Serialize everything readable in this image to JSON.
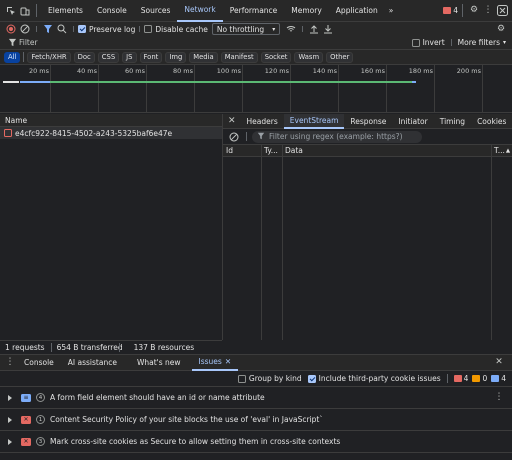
{
  "topbar": {
    "tabs": [
      "Elements",
      "Console",
      "Sources",
      "Network",
      "Performance",
      "Memory",
      "Application"
    ],
    "active_tab": "Network",
    "more": "»",
    "error_count": "4"
  },
  "toolbar": {
    "preserve_log": "Preserve log",
    "disable_cache": "Disable cache",
    "throttling": "No throttling"
  },
  "filter": {
    "placeholder": "Filter",
    "invert": "Invert",
    "more_filters": "More filters"
  },
  "chips": [
    "All",
    "Fetch/XHR",
    "Doc",
    "CSS",
    "JS",
    "Font",
    "Img",
    "Media",
    "Manifest",
    "Socket",
    "Wasm",
    "Other"
  ],
  "overview": {
    "ticks": [
      "20 ms",
      "40 ms",
      "60 ms",
      "80 ms",
      "100 ms",
      "120 ms",
      "140 ms",
      "160 ms",
      "180 ms",
      "200 ms"
    ]
  },
  "requests": {
    "header": "Name",
    "rows": [
      "e4cfc922-8415-4502-a243-5325baf6e47e"
    ]
  },
  "detail": {
    "tabs": [
      "Headers",
      "EventStream",
      "Response",
      "Initiator",
      "Timing",
      "Cookies"
    ],
    "active_tab": "EventStream",
    "regex_placeholder": "Filter using regex (example: https?)",
    "columns": [
      "Id",
      "Ty...",
      "Data",
      "T..."
    ]
  },
  "status": {
    "requests": "1 requests",
    "transferred": "654 B transferred",
    "resources": "137 B resources"
  },
  "drawer": {
    "tabs": [
      "Console",
      "AI assistance",
      "What's new",
      "Issues"
    ],
    "active_tab": "Issues",
    "group_by_kind": "Group by kind",
    "include_third_party": "Include third-party cookie issues",
    "counts": {
      "errors": "4",
      "warnings": "0",
      "info": "4"
    }
  },
  "issues": [
    {
      "count": "4",
      "kind": "info",
      "text": "A form field element should have an id or name attribute"
    },
    {
      "count": "1",
      "kind": "error",
      "text": "Content Security Policy of your site blocks the use of 'eval' in JavaScript`"
    },
    {
      "count": "3",
      "kind": "error",
      "text": "Mark cross-site cookies as Secure to allow setting them in cross-site contexts"
    }
  ],
  "colors": {
    "accent": "#a8c7fa",
    "error": "#e46962",
    "info": "#7cacf8",
    "waterfall_green": "#5bb974"
  }
}
